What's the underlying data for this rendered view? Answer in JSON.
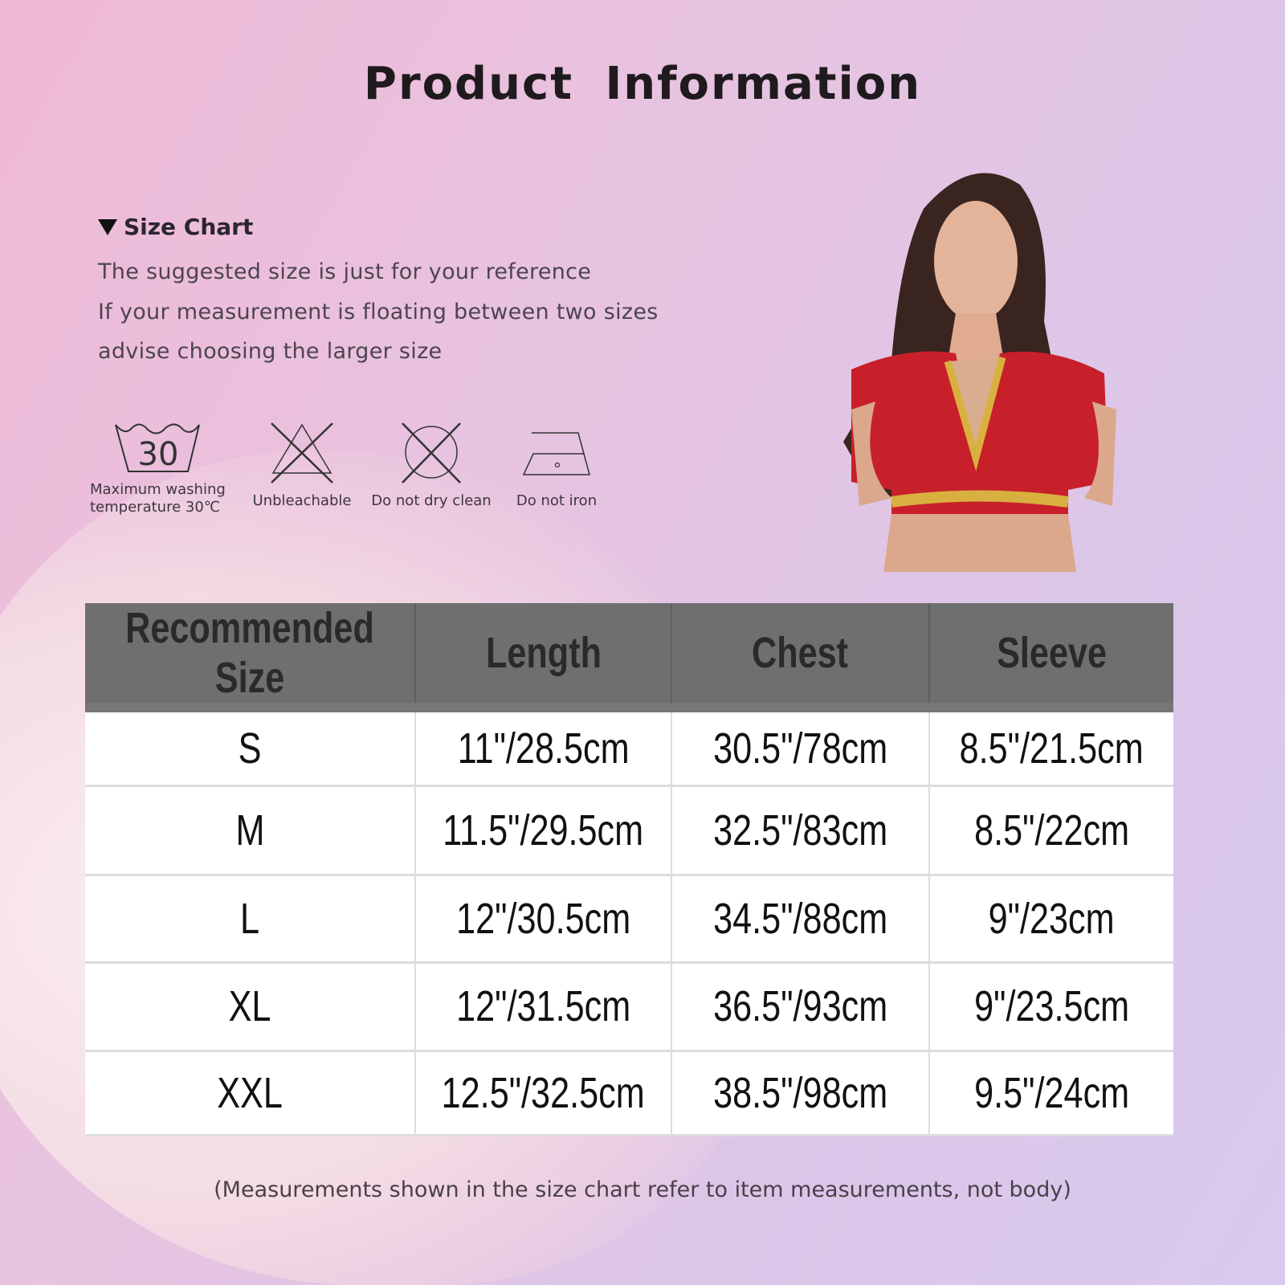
{
  "title": "Product  Information",
  "size_chart": {
    "heading": "Size Chart",
    "notes": [
      "The suggested size is just for your reference",
      "If your measurement is floating between two sizes",
      "advise choosing the larger size"
    ]
  },
  "care": [
    {
      "icon": "wash-30-icon",
      "symbol_text": "30",
      "label_lines": [
        "Maximum washing",
        "temperature 30℃"
      ]
    },
    {
      "icon": "no-bleach-icon",
      "label_lines": [
        "Unbleachable"
      ]
    },
    {
      "icon": "no-dry-clean-icon",
      "label_lines": [
        "Do not dry clean"
      ]
    },
    {
      "icon": "no-iron-icon",
      "label_lines": [
        "Do not iron"
      ]
    }
  ],
  "table": {
    "headers": [
      "Recommended Size",
      "Length",
      "Chest",
      "Sleeve"
    ],
    "rows": [
      [
        "S",
        "11\"/28.5cm",
        "30.5\"/78cm",
        "8.5\"/21.5cm"
      ],
      [
        "M",
        "11.5\"/29.5cm",
        "32.5\"/83cm",
        "8.5\"/22cm"
      ],
      [
        "L",
        "12\"/30.5cm",
        "34.5\"/88cm",
        "9\"/23cm"
      ],
      [
        "XL",
        "12\"/31.5cm",
        "36.5\"/93cm",
        "9\"/23.5cm"
      ],
      [
        "XXL",
        "12.5\"/32.5cm",
        "38.5\"/98cm",
        "9.5\"/24cm"
      ]
    ]
  },
  "footnote": "(Measurements shown in the size chart refer to item measurements, not body)"
}
